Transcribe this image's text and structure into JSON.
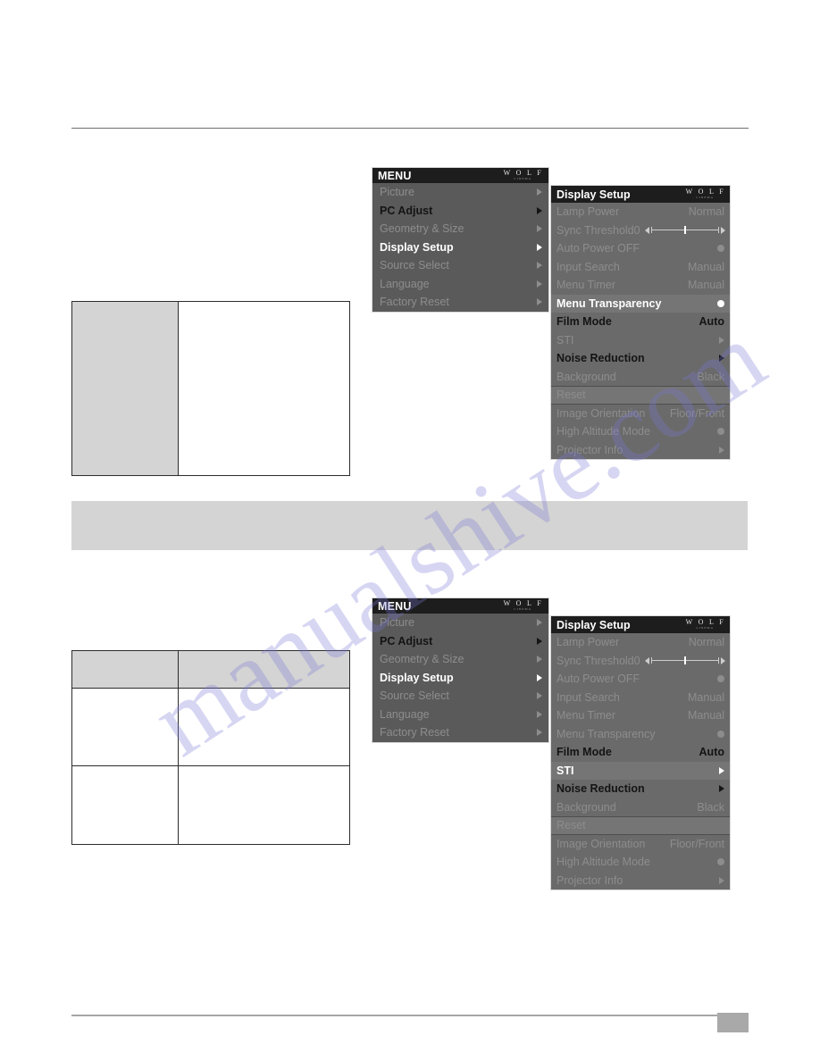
{
  "page": {
    "number": ""
  },
  "watermark": {
    "text": "manualshive.com"
  },
  "logo": {
    "main": "W O L F",
    "sub": "CINEMA"
  },
  "osd_top": {
    "main_menu": {
      "title": "MENU",
      "items": [
        {
          "label": "Picture",
          "state": "dim",
          "glyph": "arrow"
        },
        {
          "label": "PC Adjust",
          "state": "normal",
          "glyph": "arrow"
        },
        {
          "label": "Geometry & Size",
          "state": "dim",
          "glyph": "arrow"
        },
        {
          "label": "Display Setup",
          "state": "active",
          "glyph": "arrow"
        },
        {
          "label": "Source Select",
          "state": "dim",
          "glyph": "arrow"
        },
        {
          "label": "Language",
          "state": "dim",
          "glyph": "arrow"
        },
        {
          "label": "Factory Reset",
          "state": "dim",
          "glyph": "arrow"
        }
      ]
    },
    "sub_menu": {
      "title": "Display Setup",
      "items": [
        {
          "label": "Lamp Power",
          "value": "Normal",
          "state": "dim",
          "glyph": "value"
        },
        {
          "label": "Sync Threshold",
          "value": "0",
          "state": "dim",
          "glyph": "slider"
        },
        {
          "label": "Auto Power OFF",
          "value": "",
          "state": "dim",
          "glyph": "dot"
        },
        {
          "label": "Input Search",
          "value": "Manual",
          "state": "dim",
          "glyph": "value"
        },
        {
          "label": "Menu Timer",
          "value": "Manual",
          "state": "dim",
          "glyph": "value"
        },
        {
          "label": "Menu Transparency",
          "value": "",
          "state": "active",
          "glyph": "dot"
        },
        {
          "label": "Film Mode",
          "value": "Auto",
          "state": "normal",
          "glyph": "value"
        },
        {
          "label": "STI",
          "value": "",
          "state": "dim",
          "glyph": "arrow"
        },
        {
          "label": "Noise Reduction",
          "value": "",
          "state": "normal",
          "glyph": "arrow"
        },
        {
          "label": "Background",
          "value": "Black",
          "state": "dim",
          "glyph": "value"
        },
        {
          "label": "Reset",
          "value": "",
          "state": "dim",
          "glyph": "none",
          "band": true
        },
        {
          "label": "Image Orientation",
          "value": "Floor/Front",
          "state": "dim",
          "glyph": "value"
        },
        {
          "label": "High Altitude Mode",
          "value": "",
          "state": "dim",
          "glyph": "dot"
        },
        {
          "label": "Projector Info",
          "value": "",
          "state": "dim",
          "glyph": "arrow"
        }
      ]
    }
  },
  "osd_bottom": {
    "main_menu": {
      "title": "MENU",
      "items": [
        {
          "label": "Picture",
          "state": "dim",
          "glyph": "arrow"
        },
        {
          "label": "PC Adjust",
          "state": "normal",
          "glyph": "arrow"
        },
        {
          "label": "Geometry & Size",
          "state": "dim",
          "glyph": "arrow"
        },
        {
          "label": "Display Setup",
          "state": "active",
          "glyph": "arrow"
        },
        {
          "label": "Source Select",
          "state": "dim",
          "glyph": "arrow"
        },
        {
          "label": "Language",
          "state": "dim",
          "glyph": "arrow"
        },
        {
          "label": "Factory Reset",
          "state": "dim",
          "glyph": "arrow"
        }
      ]
    },
    "sub_menu": {
      "title": "Display Setup",
      "items": [
        {
          "label": "Lamp Power",
          "value": "Normal",
          "state": "dim",
          "glyph": "value"
        },
        {
          "label": "Sync Threshold",
          "value": "0",
          "state": "dim",
          "glyph": "slider"
        },
        {
          "label": "Auto Power OFF",
          "value": "",
          "state": "dim",
          "glyph": "dot"
        },
        {
          "label": "Input Search",
          "value": "Manual",
          "state": "dim",
          "glyph": "value"
        },
        {
          "label": "Menu Timer",
          "value": "Manual",
          "state": "dim",
          "glyph": "value"
        },
        {
          "label": "Menu Transparency",
          "value": "",
          "state": "dim",
          "glyph": "dot"
        },
        {
          "label": "Film Mode",
          "value": "Auto",
          "state": "normal",
          "glyph": "value"
        },
        {
          "label": "STI",
          "value": "",
          "state": "active",
          "glyph": "arrow"
        },
        {
          "label": "Noise Reduction",
          "value": "",
          "state": "normal",
          "glyph": "arrow"
        },
        {
          "label": "Background",
          "value": "Black",
          "state": "dim",
          "glyph": "value"
        },
        {
          "label": "Reset",
          "value": "",
          "state": "dim",
          "glyph": "none",
          "band": true
        },
        {
          "label": "Image Orientation",
          "value": "Floor/Front",
          "state": "dim",
          "glyph": "value"
        },
        {
          "label": "High Altitude Mode",
          "value": "",
          "state": "dim",
          "glyph": "dot"
        },
        {
          "label": "Projector Info",
          "value": "",
          "state": "dim",
          "glyph": "arrow"
        }
      ]
    }
  }
}
